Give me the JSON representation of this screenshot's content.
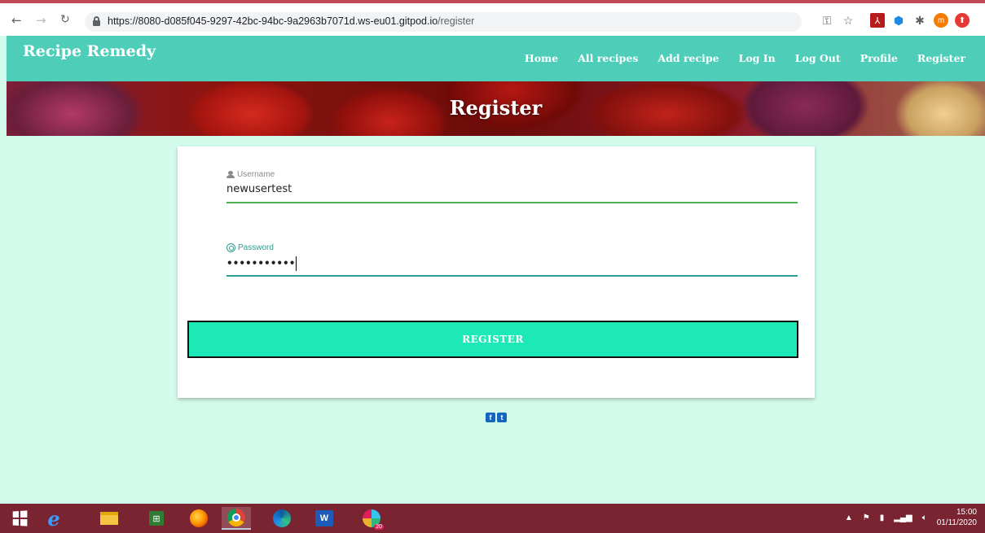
{
  "browser": {
    "url_host": "https://8080-d085f045-9297-42bc-94bc-9a2963b7071d.ws-eu01.gitpod.io",
    "url_path": "/register",
    "profile_initial": "m"
  },
  "site": {
    "brand": "Recipe Remedy",
    "nav": [
      "Home",
      "All recipes",
      "Add recipe",
      "Log In",
      "Log Out",
      "Profile",
      "Register"
    ]
  },
  "hero": {
    "title": "Register"
  },
  "form": {
    "username_label": "Username",
    "username_value": "newusertest",
    "password_label": "Password",
    "password_value": "•••••••••••",
    "submit_label": "REGISTER"
  },
  "social": {
    "facebook": "f",
    "twitter": "t"
  },
  "taskbar": {
    "time": "15:00",
    "date": "01/11/2020",
    "slack_badge": "20"
  },
  "colors": {
    "nav_bg": "#4ecdb9",
    "page_bg": "#d3fbeb",
    "button_bg": "#1de9b6",
    "taskbar_bg": "#7a2432"
  }
}
